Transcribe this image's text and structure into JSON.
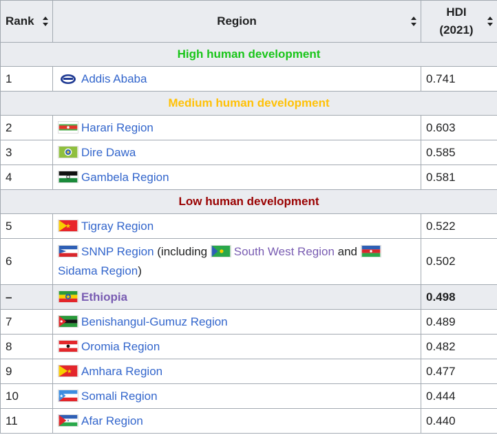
{
  "headers": {
    "rank": "Rank",
    "region": "Region",
    "hdi_line1": "HDI",
    "hdi_line2": "(2021)"
  },
  "groups": {
    "high": "High human development",
    "medium": "Medium human development",
    "low": "Low human development"
  },
  "rows": [
    {
      "rank": "1",
      "name": "Addis Ababa",
      "hdi": "0.741",
      "flag": "addis-ababa-seal-icon"
    },
    {
      "rank": "2",
      "name": "Harari Region",
      "hdi": "0.603",
      "flag": "harari-flag-icon"
    },
    {
      "rank": "3",
      "name": "Dire Dawa",
      "hdi": "0.585",
      "flag": "dire-dawa-flag-icon"
    },
    {
      "rank": "4",
      "name": "Gambela Region",
      "hdi": "0.581",
      "flag": "gambela-flag-icon"
    },
    {
      "rank": "5",
      "name": "Tigray Region",
      "hdi": "0.522",
      "flag": "tigray-flag-icon"
    },
    {
      "rank": "6",
      "name": "SNNP Region",
      "text1": " (including ",
      "name2": "South West Region",
      "text2": " and ",
      "name3": "Sidama Region",
      "text3": ")",
      "hdi": "0.502",
      "flag": "snnp-flag-icon"
    },
    {
      "rank": "–",
      "name": "Ethiopia",
      "hdi": "0.498",
      "flag": "ethiopia-flag-icon"
    },
    {
      "rank": "7",
      "name": "Benishangul-Gumuz Region",
      "hdi": "0.489",
      "flag": "benishangul-gumuz-flag-icon"
    },
    {
      "rank": "8",
      "name": "Oromia Region",
      "hdi": "0.482",
      "flag": "oromia-flag-icon"
    },
    {
      "rank": "9",
      "name": "Amhara Region",
      "hdi": "0.477",
      "flag": "amhara-flag-icon"
    },
    {
      "rank": "10",
      "name": "Somali Region",
      "hdi": "0.444",
      "flag": "somali-flag-icon"
    },
    {
      "rank": "11",
      "name": "Afar Region",
      "hdi": "0.440",
      "flag": "afar-flag-icon"
    }
  ],
  "colors": {
    "link": "#3366cc",
    "visited": "#795cb2",
    "high": "#19c519",
    "medium": "#ffc107",
    "low": "#990000",
    "header_bg": "#eaecf0",
    "border": "#a2a9b1"
  }
}
